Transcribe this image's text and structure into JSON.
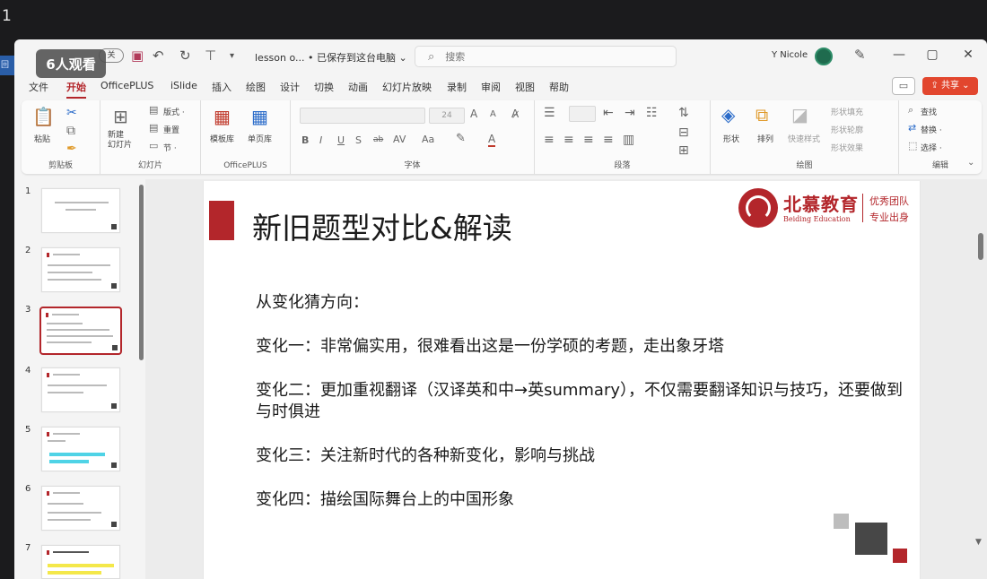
{
  "overlay": {
    "marker": "1",
    "viewers": "6人观看",
    "strip": "回"
  },
  "titlebar": {
    "toggle": "关",
    "filename": "lesson o... • 已保存到这台电脑 ⌄",
    "search_placeholder": "搜索",
    "user": "Y Nicole",
    "minimize": "—",
    "maximize": "▢",
    "close": "✕"
  },
  "menu": {
    "tabs": [
      "文件",
      "开始",
      "OfficePLUS",
      "iSlide",
      "插入",
      "绘图",
      "设计",
      "切换",
      "动画",
      "幻灯片放映",
      "录制",
      "审阅",
      "视图",
      "帮助"
    ],
    "comment": "▭",
    "share": "⇪ 共享 ⌄"
  },
  "ribbon": {
    "clipboard": {
      "label": "剪贴板",
      "paste": "粘贴"
    },
    "slides": {
      "label": "幻灯片",
      "new_slide": "新建\n幻灯片",
      "layout": "版式 ·",
      "reset": "重置",
      "section": "节 ·"
    },
    "officeplus": {
      "label": "OfficePLUS",
      "template_lib": "模板库",
      "page_lib": "单页库"
    },
    "font": {
      "label": "字体",
      "size": "24",
      "bold": "B",
      "italic": "I",
      "underline": "U",
      "strike": "S",
      "shadow": "ab",
      "spacing": "AV",
      "case": "Aa",
      "highlight": "🖉",
      "color": "A"
    },
    "paragraph": {
      "label": "段落"
    },
    "drawing": {
      "label": "绘图",
      "shape": "形状",
      "arrange": "排列",
      "quick_styles": "快速样式",
      "fill": "形状填充",
      "outline": "形状轮廓",
      "effects": "形状效果"
    },
    "editing": {
      "label": "编辑",
      "find": "查找",
      "replace": "替换 ·",
      "select": "选择 ·"
    }
  },
  "thumbnails": [
    {
      "num": "1"
    },
    {
      "num": "2"
    },
    {
      "num": "3",
      "selected": true
    },
    {
      "num": "4"
    },
    {
      "num": "5"
    },
    {
      "num": "6"
    },
    {
      "num": "7"
    }
  ],
  "slide": {
    "title": "新旧题型对比&解读",
    "logo": {
      "name_cn": "北慕教育",
      "name_en": "Beiding Education",
      "tag1": "优秀团队",
      "tag2": "专业出身"
    },
    "lines": [
      "从变化猜方向：",
      "变化一：非常偏实用，很难看出这是一份学硕的考题，走出象牙塔",
      "变化二：更加重视翻译（汉译英和中→英summary），不仅需要翻译知识与技巧，还要做到与时俱进",
      "变化三：关注新时代的各种新变化，影响与挑战",
      "变化四：描绘国际舞台上的中国形象"
    ]
  },
  "colors": {
    "accent": "#b3262b",
    "share": "#e2462e",
    "avatar": "#1f6b4e"
  }
}
